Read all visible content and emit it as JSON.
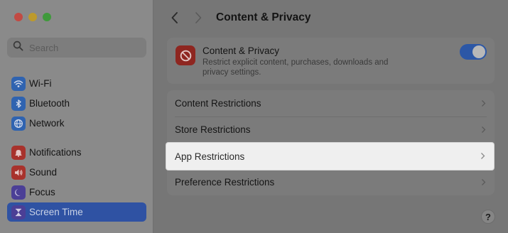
{
  "window": {
    "title": "Content & Privacy"
  },
  "sidebar": {
    "search": {
      "placeholder": "Search",
      "value": ""
    },
    "items": [
      {
        "label": "Wi-Fi",
        "icon": "wifi-icon",
        "color": "#2f63b0"
      },
      {
        "label": "Bluetooth",
        "icon": "bluetooth-icon",
        "color": "#2f63b0"
      },
      {
        "label": "Network",
        "icon": "globe-icon",
        "color": "#2f63b0"
      },
      {
        "label": "Notifications",
        "icon": "bell-icon",
        "color": "#a8322c"
      },
      {
        "label": "Sound",
        "icon": "speaker-icon",
        "color": "#a8322c"
      },
      {
        "label": "Focus",
        "icon": "moon-icon",
        "color": "#4b3f96"
      },
      {
        "label": "Screen Time",
        "icon": "hourglass-icon",
        "color": "#4b3f96",
        "selected": true
      }
    ]
  },
  "main": {
    "card": {
      "title": "Content & Privacy",
      "description": "Restrict explicit content, purchases, downloads and privacy settings.",
      "toggle_on": true,
      "icon": "restricted-icon"
    },
    "rows": [
      {
        "label": "Content Restrictions"
      },
      {
        "label": "Store Restrictions"
      },
      {
        "label": "App Restrictions",
        "highlighted": true
      },
      {
        "label": "Preference Restrictions"
      }
    ],
    "help_label": "?"
  },
  "colors": {
    "accent": "#2f52a3",
    "highlight_bg": "#efefef"
  }
}
